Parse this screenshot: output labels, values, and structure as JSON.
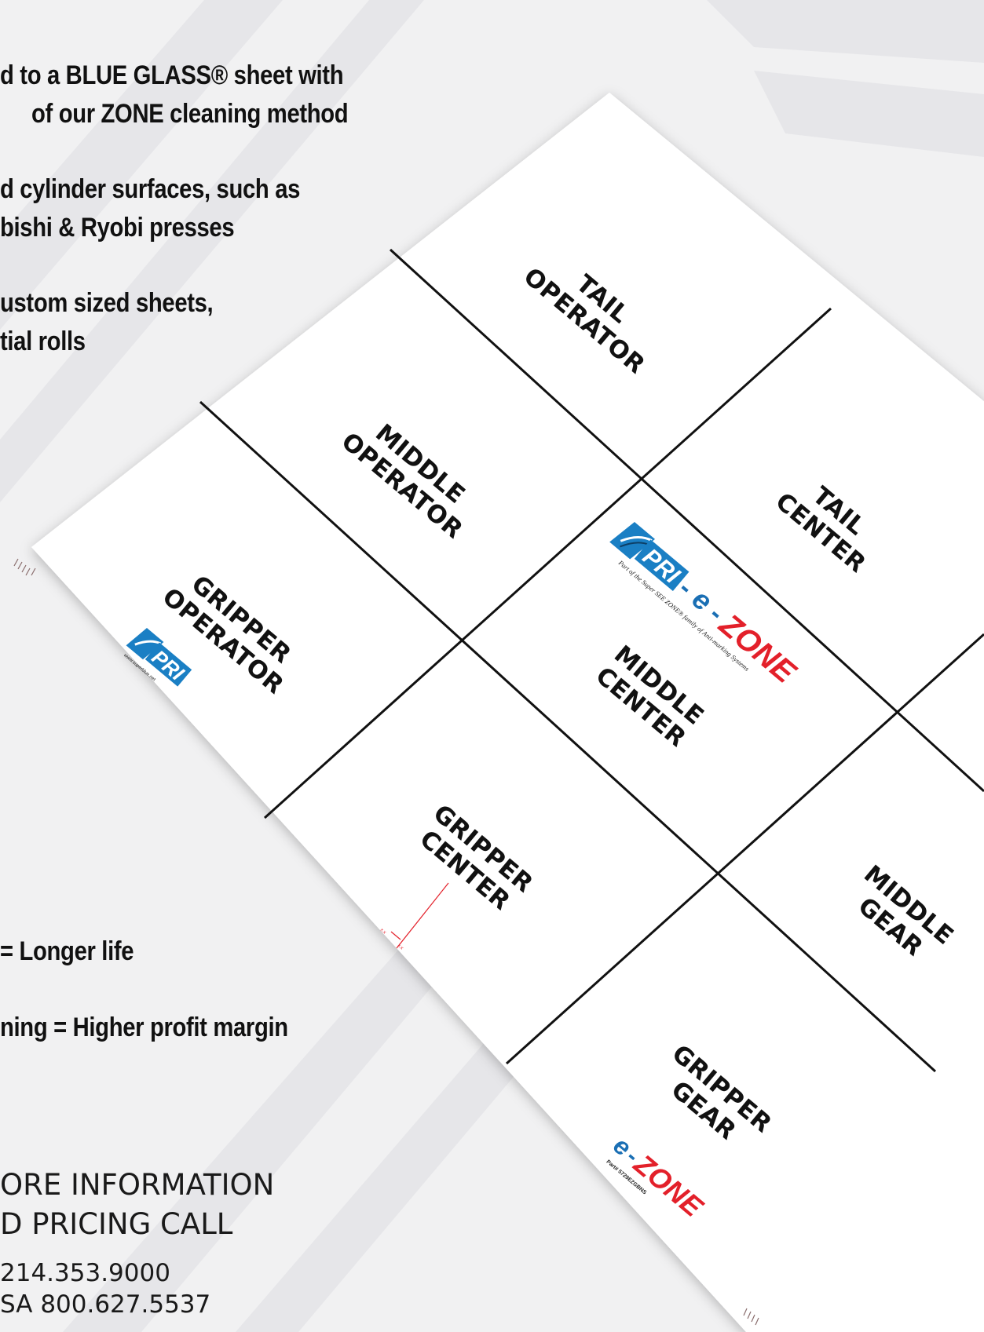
{
  "copy": {
    "lines": [
      "d to a BLUE GLASS® sheet with",
      "of our ZONE cleaning method",
      "d cylinder surfaces, such as",
      "bishi & Ryobi presses",
      "ustom sized sheets,",
      "tial rolls",
      "= Longer life",
      "ning = Higher profit margin"
    ]
  },
  "info": {
    "line1": "ORE INFORMATION",
    "line2": "D PRICING CALL",
    "phone1": "214.353.9000",
    "phone2": "SA 800.627.5537"
  },
  "sheet": {
    "cells": [
      {
        "line1": "TAIL",
        "line2": "OPERATOR"
      },
      {
        "line1": "TAIL",
        "line2": "CENTER"
      },
      {
        "line1": "MIDDLE",
        "line2": "OPERATOR"
      },
      {
        "line1": "MIDDLE",
        "line2": "CENTER"
      },
      {
        "line1": "MIDDLE",
        "line2": "GEAR"
      },
      {
        "line1": "GRIPPER",
        "line2": "OPERATOR"
      },
      {
        "line1": "GRIPPER",
        "line2": "CENTER"
      },
      {
        "line1": "GRIPPER",
        "line2": "GEAR"
      }
    ],
    "logo_center": {
      "pri": "PRI",
      "dash1": "-",
      "e": "e",
      "dash2": "-",
      "zone": "ZONE",
      "tagline": "Part of the Super SEE ZONE® family of Anti-marking Systems"
    },
    "logo_small": {
      "pri": "PRI",
      "url": "www.superblue.net"
    },
    "logo_ezone": {
      "e": "e",
      "dash": "-",
      "zone": "ZONE",
      "part": "Part# 5729EZGBNS"
    },
    "marks": {
      "left": "x.x",
      "right": "x.x"
    }
  },
  "colors": {
    "background": "#f1f1f2",
    "pri_blue": "#1a7fc4",
    "zone_red": "#e3202a",
    "dash_blue": "#1a6fb4"
  }
}
